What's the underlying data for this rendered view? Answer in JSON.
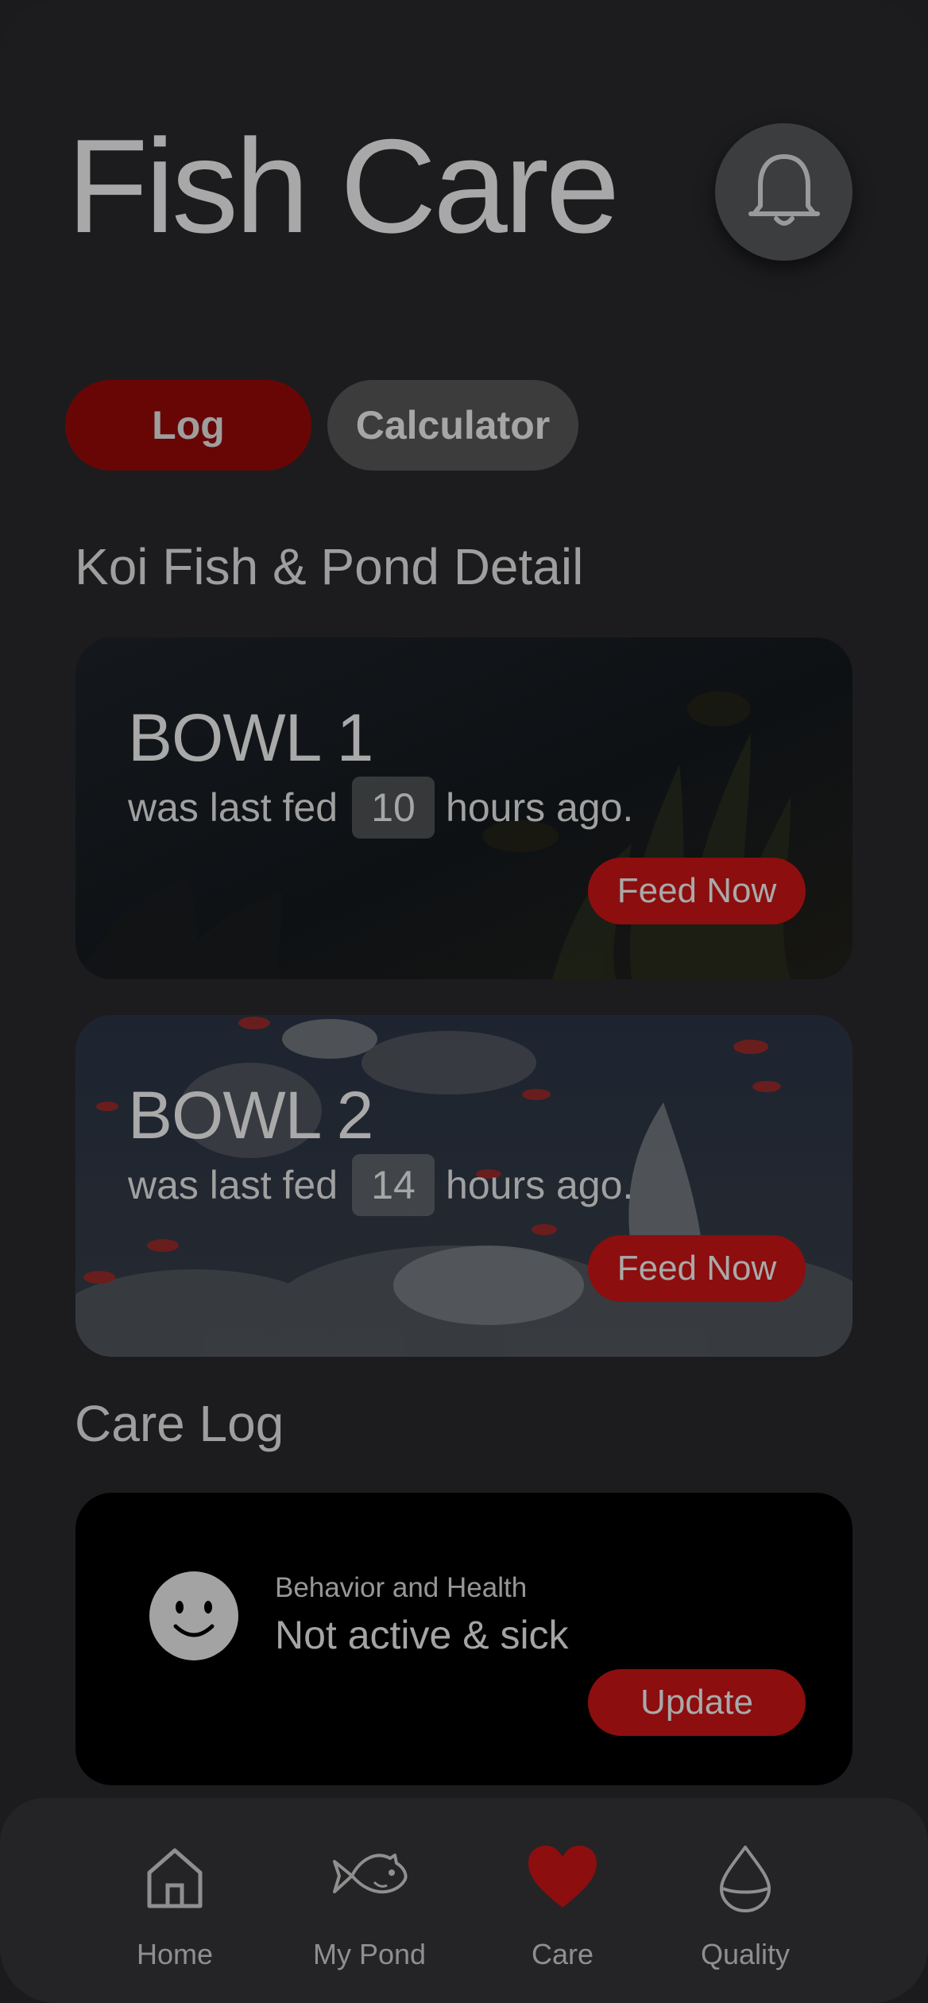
{
  "header": {
    "title": "Fish Care",
    "notification_icon": "bell-icon"
  },
  "tabs": [
    {
      "label": "Log",
      "active": true
    },
    {
      "label": "Calculator",
      "active": false
    }
  ],
  "pond_section": {
    "title": "Koi Fish & Pond Detail"
  },
  "bowls": [
    {
      "name": "BOWL 1",
      "prefix": "was last fed",
      "hours": "10",
      "suffix": "hours ago.",
      "button_label": "Feed Now"
    },
    {
      "name": "BOWL 2",
      "prefix": "was last fed",
      "hours": "14",
      "suffix": "hours ago.",
      "button_label": "Feed Now"
    }
  ],
  "care_log": {
    "title": "Care Log",
    "entry": {
      "icon": "smiley-face-icon",
      "label": "Behavior and Health",
      "value": "Not active & sick",
      "button_label": "Update"
    }
  },
  "nav": {
    "items": [
      {
        "label": "Home",
        "icon": "home-icon",
        "active": false
      },
      {
        "label": "My Pond",
        "icon": "fish-icon",
        "active": false
      },
      {
        "label": "Care",
        "icon": "heart-icon",
        "active": true
      },
      {
        "label": "Quality",
        "icon": "water-drop-icon",
        "active": false
      }
    ]
  },
  "colors": {
    "accent_red": "#8c0e0e",
    "active_tab": "#680606",
    "background": "#1c1c1e",
    "card_dark": "#000000"
  }
}
